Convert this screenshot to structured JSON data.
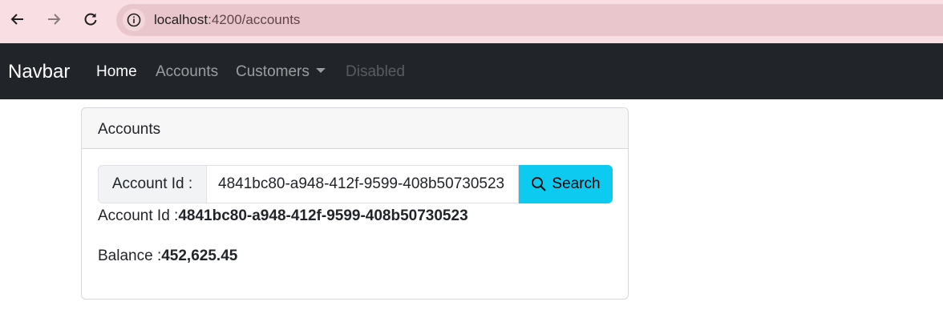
{
  "browser": {
    "url_host": "localhost",
    "url_rest": ":4200/accounts"
  },
  "navbar": {
    "brand": "Navbar",
    "links": [
      {
        "label": "Home"
      },
      {
        "label": "Accounts"
      },
      {
        "label": "Customers"
      },
      {
        "label": "Disabled"
      }
    ]
  },
  "card": {
    "header": "Accounts",
    "search": {
      "prefix": "Account Id :",
      "value": "4841bc80-a948-412f-9599-408b50730523",
      "button_label": "Search"
    },
    "account_id_label": "Account Id :",
    "account_id_value": "4841bc80-a948-412f-9599-408b50730523",
    "balance_label": "Balance :",
    "balance_value": "452,625.45"
  },
  "colors": {
    "browser_bar": "#f9dfe3",
    "navbar": "#212529",
    "search_button": "#0dcaf0"
  }
}
